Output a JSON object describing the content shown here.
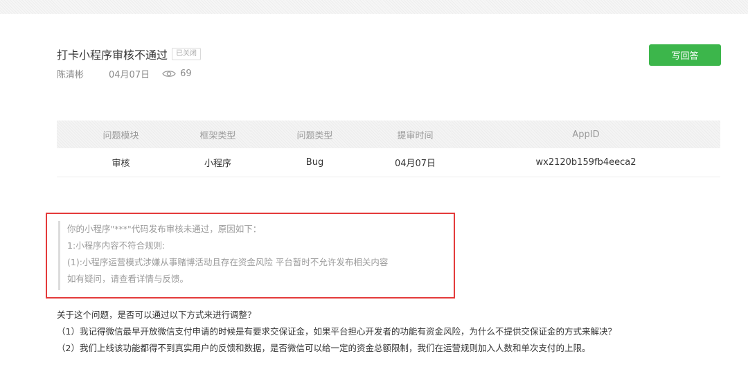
{
  "post": {
    "title": "打卡小程序审核不通过",
    "status_badge": "已关闭",
    "author": "陈清彬",
    "date": "04月07日",
    "views": "69",
    "reply_button": "写回答"
  },
  "info_table": {
    "headers": [
      "问题模块",
      "框架类型",
      "问题类型",
      "提审时间",
      "AppID"
    ],
    "values": [
      "审核",
      "小程序",
      "Bug",
      "04月07日",
      "wx2120b159fb4eeca2"
    ]
  },
  "review_notice": {
    "lines": [
      "你的小程序\"***\"代码发布审核未通过，原因如下：",
      "1:小程序内容不符合规则:",
      "(1):小程序运营模式涉嫌从事赌博活动且存在资金风险 平台暂时不允许发布相关内容",
      "如有疑问，请查看详情与反馈。"
    ],
    "highlight_color": "#e43b3b"
  },
  "question": {
    "lines": [
      "关于这个问题，是否可以通过以下方式来进行调整？",
      "（1）我记得微信最早开放微信支付申请的时候是有要求交保证金，如果平台担心开发者的功能有资金风险，为什么不提供交保证金的方式来解决？",
      "（2）我们上线该功能都得不到真实用户的反馈和数据，是否微信可以给一定的资金总额限制，我们在运营规则加入人数和单次支付的上限。"
    ]
  },
  "colors": {
    "accent": "#3cb64b",
    "text": "#353535",
    "muted": "#9b9b9b"
  }
}
